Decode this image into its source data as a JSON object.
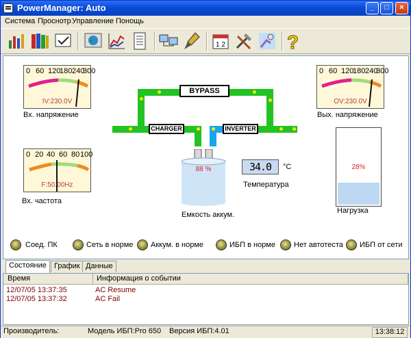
{
  "window": {
    "title": "PowerManager: Auto"
  },
  "menu": [
    "Система",
    "Проснотр",
    "Управление",
    "Понощь"
  ],
  "toolbar": {
    "icons": [
      "chart-bars-icon",
      "books-icon",
      "document-check-icon",
      "globe-icon",
      "line-chart-icon",
      "list-document-icon",
      "computers-icon",
      "brush-icon",
      "calendar-icon",
      "tools-icon",
      "satellite-icon",
      "help-icon"
    ]
  },
  "meters": {
    "input_voltage": {
      "scale": [
        "0",
        "60",
        "120",
        "180",
        "240",
        "300"
      ],
      "reading": "IV:230.0V",
      "label": "Вх. напряжение",
      "value": 230,
      "max": 300
    },
    "output_voltage": {
      "scale": [
        "0",
        "60",
        "120",
        "180",
        "240",
        "300"
      ],
      "reading": "OV:230.0V",
      "label": "Вых. напряжение",
      "value": 230,
      "max": 300
    },
    "input_frequency": {
      "scale": [
        "0",
        "20",
        "40",
        "60",
        "80",
        "100"
      ],
      "reading": "F:50.00Hz",
      "label": "Вх. частота",
      "value": 50,
      "max": 100
    }
  },
  "flow": {
    "bypass": "BYPASS",
    "charger": "CHARGER",
    "inverter": "INVERTER"
  },
  "battery": {
    "percent": "88 %",
    "label": "Емкость аккум."
  },
  "temperature": {
    "value": "34.0",
    "unit": "°C",
    "label": "Температура"
  },
  "load": {
    "percent": "28%",
    "fraction": 0.28,
    "label": "Нагрузка"
  },
  "indicators": [
    "Соед. ПК",
    "Сеть в норме",
    "Аккум. в норме",
    "ИБП в норме",
    "Нет автотеста",
    "ИБП от сети"
  ],
  "tabs": [
    "Состояние",
    "График",
    "Данные"
  ],
  "events": {
    "columns": [
      "Время",
      "Информация о событии"
    ],
    "rows": [
      {
        "time": "12/07/05 13:37:35",
        "info": "AC Resume"
      },
      {
        "time": "12/07/05 13:37:32",
        "info": "AC Fail"
      }
    ]
  },
  "status": {
    "manufacturer": "Производитель:",
    "model": "Модель ИБП:Pro 650",
    "version": "Версия ИБП:4.01",
    "clock": "13:38:12"
  },
  "colors": {
    "pipe": "#22c322",
    "pipe_blue": "#18a5ee",
    "title_bar": "#0a4ad8",
    "event_text": "#800000"
  }
}
